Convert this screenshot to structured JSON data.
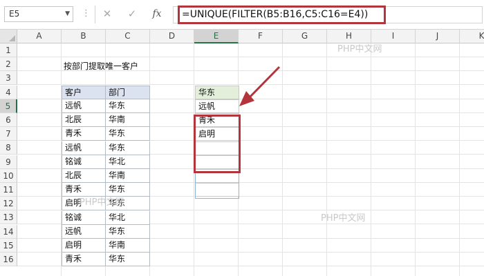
{
  "formula_bar": {
    "name_box": "E5",
    "cancel_glyph": "✕",
    "enter_glyph": "✓",
    "fx_label": "fx",
    "formula": "=UNIQUE(FILTER(B5:B16,C5:C16=E4))"
  },
  "columns": [
    "A",
    "B",
    "C",
    "D",
    "E",
    "F",
    "G",
    "H",
    "I",
    "J",
    "K"
  ],
  "selected_column": "E",
  "rows": [
    "1",
    "2",
    "3",
    "4",
    "5",
    "6",
    "7",
    "8",
    "9",
    "10",
    "11",
    "12",
    "13",
    "14",
    "15",
    "16"
  ],
  "selected_row": "5",
  "title": "按部门提取唯一客户",
  "table": {
    "headers": [
      "客户",
      "部门"
    ],
    "rows": [
      [
        "远帆",
        "华东"
      ],
      [
        "北辰",
        "华南"
      ],
      [
        "青禾",
        "华东"
      ],
      [
        "远帆",
        "华东"
      ],
      [
        "铭诚",
        "华北"
      ],
      [
        "北辰",
        "华南"
      ],
      [
        "青禾",
        "华东"
      ],
      [
        "启明",
        "华东"
      ],
      [
        "铭诚",
        "华北"
      ],
      [
        "远帆",
        "华东"
      ],
      [
        "启明",
        "华南"
      ],
      [
        "青禾",
        "华东"
      ]
    ]
  },
  "result": {
    "criteria": "华东",
    "values": [
      "远帆",
      "青禾",
      "启明"
    ]
  },
  "watermarks": [
    "PHP中文网",
    "PHP中文网",
    "PHP中文网"
  ],
  "colors": {
    "highlight": "#b3343a",
    "excel_green": "#217346",
    "table_header": "#dce3f0"
  }
}
